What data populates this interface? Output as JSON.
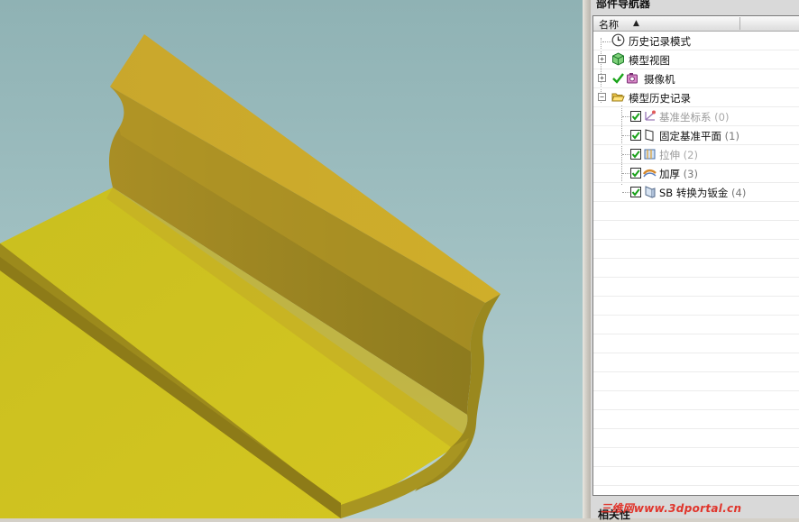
{
  "panel": {
    "title": "部件导航器",
    "column_name": "名称",
    "bottom_title": "相关性"
  },
  "tree": {
    "history_mode": {
      "label": "历史记录模式",
      "icon": "clock-icon"
    },
    "model_views": {
      "label": "模型视图",
      "icon": "views-cube-icon",
      "expander": "+"
    },
    "cameras": {
      "label": "摄像机",
      "icon": "camera-icon",
      "expander": "+"
    },
    "model_history": {
      "label": "模型历史记录",
      "icon": "open-folder-icon",
      "expander": "−"
    },
    "features": [
      {
        "label": "基准坐标系",
        "count": "(0)",
        "icon": "datum-csys-icon",
        "checked": true,
        "dimmed": true
      },
      {
        "label": "固定基准平面",
        "count": "(1)",
        "icon": "datum-plane-icon",
        "checked": true,
        "dimmed": false
      },
      {
        "label": "拉伸",
        "count": "(2)",
        "icon": "extrude-icon",
        "checked": true,
        "dimmed": true
      },
      {
        "label": "加厚",
        "count": "(3)",
        "icon": "thicken-icon",
        "checked": true,
        "dimmed": false
      },
      {
        "label": "SB 转换为钣金",
        "count": "(4)",
        "icon": "sheet-metal-convert-icon",
        "checked": true,
        "dimmed": false
      }
    ]
  },
  "watermark": "三维网www.3dportal.cn",
  "colors": {
    "viewport_top": "#8fb2b4",
    "part_top": "#d3c221",
    "part_shadow": "#7e6d1b",
    "checkbox_green": "#18a018"
  }
}
